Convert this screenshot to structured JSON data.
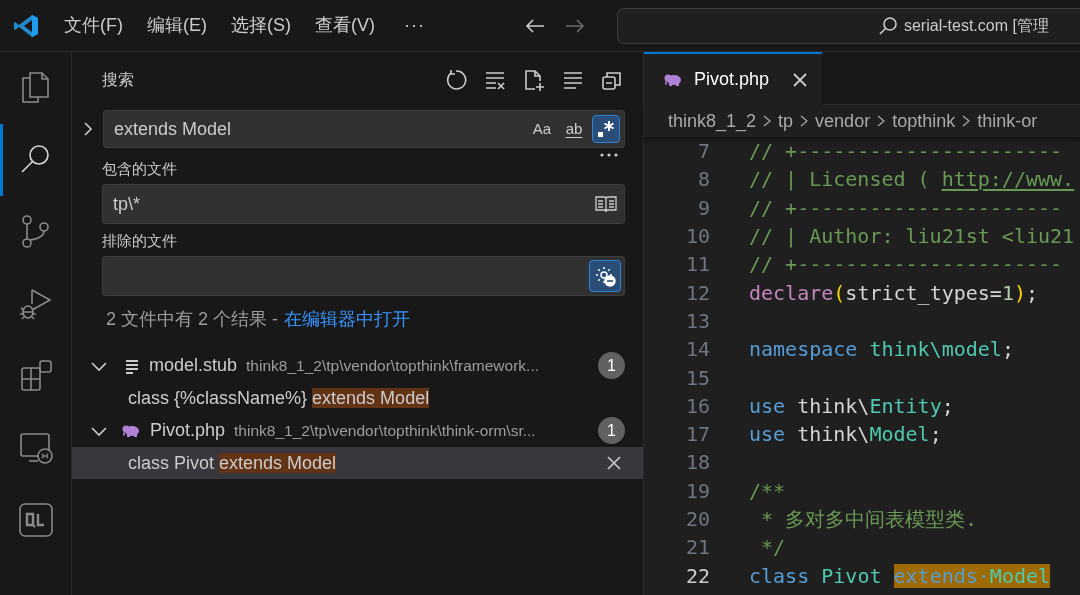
{
  "title_bar": {
    "menus": [
      "文件(F)",
      "编辑(E)",
      "选择(S)",
      "查看(V)"
    ],
    "more": "···",
    "search": "serial-test.com [管理"
  },
  "activity_bar": {
    "items": [
      {
        "kind": "explorer",
        "selected": false
      },
      {
        "kind": "search",
        "selected": true
      },
      {
        "kind": "source-control",
        "selected": false
      },
      {
        "kind": "run-debug",
        "selected": false
      },
      {
        "kind": "extensions",
        "selected": false
      },
      {
        "kind": "remote",
        "selected": false
      },
      {
        "kind": "ql",
        "selected": false
      }
    ]
  },
  "search_panel": {
    "title": "搜索",
    "query": "extends Model",
    "options": [
      {
        "kind": "case",
        "label": "Aa",
        "on": false
      },
      {
        "kind": "word",
        "label": "ab",
        "on": false
      },
      {
        "kind": "regex",
        "on": true
      }
    ],
    "include": {
      "label": "包含的文件",
      "value": "tp\\*"
    },
    "exclude": {
      "label": "排除的文件",
      "use_settings": true
    },
    "summary": {
      "text": "2 文件中有 2 个结果 -",
      "link": "在编辑器中打开"
    },
    "results": [
      {
        "file": "model.stub",
        "kind": "text",
        "path": "think8_1_2\\tp\\vendor\\topthink\\framework...",
        "count": "1",
        "expanded": true,
        "matches": [
          {
            "before": "class {%className%} ",
            "match": "extends Model",
            "selected": false
          }
        ]
      },
      {
        "file": "Pivot.php",
        "kind": "php",
        "path": "think8_1_2\\tp\\vendor\\topthink\\think-orm\\sr...",
        "count": "1",
        "expanded": true,
        "matches": [
          {
            "before": "class Pivot ",
            "match": "extends Model",
            "selected": true
          }
        ]
      }
    ]
  },
  "editor": {
    "tabs": [
      {
        "label": "Pivot.php",
        "kind": "php",
        "selected": true
      }
    ],
    "breadcrumbs": [
      "think8_1_2",
      "tp",
      "vendor",
      "topthink",
      "think-or"
    ],
    "lines": [
      {
        "number": "7",
        "current": false,
        "tokens": [
          {
            "text": "// +----------------------",
            "kind": "comment"
          }
        ]
      },
      {
        "number": "8",
        "current": false,
        "tokens": [
          {
            "text": "// | Licensed ( ",
            "kind": "comment"
          },
          {
            "text": "http://www.",
            "kind": "link"
          }
        ]
      },
      {
        "number": "9",
        "current": false,
        "tokens": [
          {
            "text": "// +----------------------",
            "kind": "comment"
          }
        ]
      },
      {
        "number": "10",
        "current": false,
        "tokens": [
          {
            "text": "// | Author: liu21st <liu21",
            "kind": "comment"
          }
        ]
      },
      {
        "number": "11",
        "current": false,
        "tokens": [
          {
            "text": "// +----------------------",
            "kind": "comment"
          }
        ]
      },
      {
        "number": "12",
        "current": false,
        "tokens": [
          {
            "text": "declare",
            "kind": "control"
          },
          {
            "text": "(",
            "kind": "bracket"
          },
          {
            "text": "strict_types=",
            "kind": "plain"
          },
          {
            "text": "1",
            "kind": "number"
          },
          {
            "text": ")",
            "kind": "bracket"
          },
          {
            "text": ";",
            "kind": "plain"
          }
        ]
      },
      {
        "number": "13",
        "current": false
      },
      {
        "number": "14",
        "current": false,
        "tokens": [
          {
            "text": "namespace",
            "kind": "keyword"
          },
          {
            "text": " think\\model",
            "kind": "type"
          },
          {
            "text": ";",
            "kind": "plain"
          }
        ]
      },
      {
        "number": "15",
        "current": false
      },
      {
        "number": "16",
        "current": false,
        "tokens": [
          {
            "text": "use",
            "kind": "keyword"
          },
          {
            "text": " think\\",
            "kind": "plain"
          },
          {
            "text": "Entity",
            "kind": "type"
          },
          {
            "text": ";",
            "kind": "plain"
          }
        ]
      },
      {
        "number": "17",
        "current": false,
        "tokens": [
          {
            "text": "use",
            "kind": "keyword"
          },
          {
            "text": " think\\",
            "kind": "plain"
          },
          {
            "text": "Model",
            "kind": "type"
          },
          {
            "text": ";",
            "kind": "plain"
          }
        ]
      },
      {
        "number": "18",
        "current": false
      },
      {
        "number": "19",
        "current": false,
        "tokens": [
          {
            "text": "/**",
            "kind": "comment"
          }
        ]
      },
      {
        "number": "20",
        "current": false,
        "tokens": [
          {
            "text": " * 多对多中间表模型类.",
            "kind": "comment"
          }
        ]
      },
      {
        "number": "21",
        "current": false,
        "tokens": [
          {
            "text": " */",
            "kind": "comment"
          }
        ]
      },
      {
        "number": "22",
        "current": true,
        "tokens": [
          {
            "text": "class",
            "kind": "keyword"
          },
          {
            "text": " Pivot ",
            "kind": "type"
          },
          {
            "text": "extends·",
            "kind": "keyword",
            "selected": true
          },
          {
            "text": "Model",
            "kind": "type",
            "selected": true
          }
        ]
      }
    ]
  }
}
